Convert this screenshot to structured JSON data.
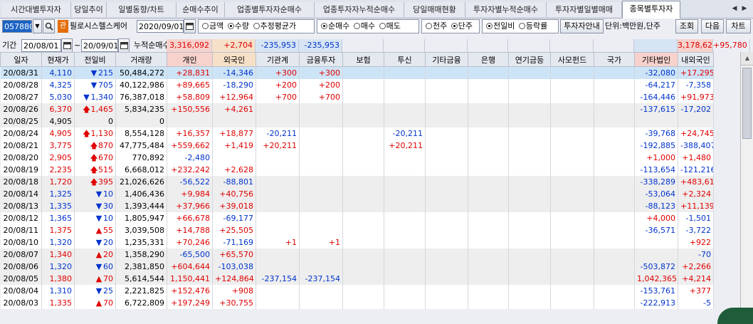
{
  "tabs": [
    "시간대별투자자",
    "당일추이",
    "일별동향/차트",
    "순매수추이",
    "업종별투자자순매수",
    "업종투자자누적순매수",
    "당일매매현황",
    "투자자별누적순매수",
    "투자자별일별매매",
    "종목별투자자"
  ],
  "active_tab": 9,
  "toolbar": {
    "stock_code": "057880",
    "badge": "관",
    "stock_name": "필로시스헬스케어",
    "date": "2020/09/01",
    "group1": [
      "금액",
      "수량",
      "추정평균가"
    ],
    "group2": [
      "순매수",
      "매수",
      "매도"
    ],
    "group3": [
      "천주",
      "단주"
    ],
    "group4": [
      "전일비",
      "등락률"
    ],
    "investor_info_button": "투자자안내",
    "unit_label": "단위:백만원,단주",
    "query_button": "조회",
    "next_button": "다음",
    "chart_button": "차트"
  },
  "period": {
    "label": "기간",
    "from": "20/08/01",
    "tilde": "~",
    "to": "20/09/01",
    "cumulative_label": "누적순매수",
    "values": [
      "3,316,092",
      "+2,704",
      "-235,953",
      "-235,953",
      "",
      "",
      "",
      "",
      "",
      "",
      "",
      "",
      "3,178,623",
      "+95,780"
    ]
  },
  "columns": [
    "일자",
    "현재가",
    "전일비",
    "거래량",
    "개인",
    "외국인",
    "기관계",
    "금융투자",
    "보험",
    "투신",
    "기타금융",
    "은행",
    "연기금등",
    "사모펀드",
    "국가",
    "기타법인",
    "내외국인"
  ],
  "rows": [
    {
      "style": "hl",
      "date": "20/08/31",
      "price": "4,110",
      "dir": "dn",
      "chg": "215",
      "vol": "50,484,272",
      "ind": "+28,831",
      "for": "-14,346",
      "inst": "+300",
      "fin": "+300",
      "ins": "",
      "trust": "",
      "etcfin": "",
      "bank": "",
      "pension": "",
      "pe": "",
      "gov": "",
      "etccorp": "-32,080",
      "dom": "+17,295"
    },
    {
      "style": "norm",
      "date": "20/08/28",
      "price": "4,325",
      "dir": "dn",
      "chg": "705",
      "vol": "40,122,986",
      "ind": "+89,665",
      "for": "-18,290",
      "inst": "+200",
      "fin": "+200",
      "ins": "",
      "trust": "",
      "etcfin": "",
      "bank": "",
      "pension": "",
      "pe": "",
      "gov": "",
      "etccorp": "-64,217",
      "dom": "-7,358"
    },
    {
      "style": "norm",
      "date": "20/08/27",
      "price": "5,030",
      "dir": "dn",
      "chg": "1,340",
      "vol": "76,387,018",
      "ind": "+58,809",
      "for": "+12,964",
      "inst": "+700",
      "fin": "+700",
      "ins": "",
      "trust": "",
      "etcfin": "",
      "bank": "",
      "pension": "",
      "pe": "",
      "gov": "",
      "etccorp": "-164,446",
      "dom": "+91,973"
    },
    {
      "style": "alt",
      "date": "20/08/26",
      "price": "6,370",
      "dir": "upb",
      "chg": "1,465",
      "vol": "5,834,235",
      "ind": "+150,556",
      "for": "+4,261",
      "inst": "",
      "fin": "",
      "ins": "",
      "trust": "",
      "etcfin": "",
      "bank": "",
      "pension": "",
      "pe": "",
      "gov": "",
      "etccorp": "-137,615",
      "dom": "-17,202"
    },
    {
      "style": "alt",
      "date": "20/08/25",
      "price": "4,905",
      "dir": "",
      "chg": "0",
      "vol": "0",
      "ind": "",
      "for": "",
      "inst": "",
      "fin": "",
      "ins": "",
      "trust": "",
      "etcfin": "",
      "bank": "",
      "pension": "",
      "pe": "",
      "gov": "",
      "etccorp": "",
      "dom": ""
    },
    {
      "style": "norm",
      "date": "20/08/24",
      "price": "4,905",
      "dir": "upb",
      "chg": "1,130",
      "vol": "8,554,128",
      "ind": "+16,357",
      "for": "+18,877",
      "inst": "-20,211",
      "fin": "",
      "ins": "",
      "trust": "-20,211",
      "etcfin": "",
      "bank": "",
      "pension": "",
      "pe": "",
      "gov": "",
      "etccorp": "-39,768",
      "dom": "+24,745"
    },
    {
      "style": "norm",
      "date": "20/08/21",
      "price": "3,775",
      "dir": "upb",
      "chg": "870",
      "vol": "47,775,484",
      "ind": "+559,662",
      "for": "+1,419",
      "inst": "+20,211",
      "fin": "",
      "ins": "",
      "trust": "+20,211",
      "etcfin": "",
      "bank": "",
      "pension": "",
      "pe": "",
      "gov": "",
      "etccorp": "-192,885",
      "dom": "-388,407"
    },
    {
      "style": "norm",
      "date": "20/08/20",
      "price": "2,905",
      "dir": "upb",
      "chg": "670",
      "vol": "770,892",
      "ind": "-2,480",
      "for": "",
      "inst": "",
      "fin": "",
      "ins": "",
      "trust": "",
      "etcfin": "",
      "bank": "",
      "pension": "",
      "pe": "",
      "gov": "",
      "etccorp": "+1,000",
      "dom": "+1,480"
    },
    {
      "style": "norm",
      "date": "20/08/19",
      "price": "2,235",
      "dir": "upb",
      "chg": "515",
      "vol": "6,668,012",
      "ind": "+232,242",
      "for": "+2,628",
      "inst": "",
      "fin": "",
      "ins": "",
      "trust": "",
      "etcfin": "",
      "bank": "",
      "pension": "",
      "pe": "",
      "gov": "",
      "etccorp": "-113,654",
      "dom": "-121,216"
    },
    {
      "style": "alt",
      "date": "20/08/18",
      "price": "1,720",
      "dir": "upb",
      "chg": "395",
      "vol": "21,026,626",
      "ind": "-56,522",
      "for": "-88,801",
      "inst": "",
      "fin": "",
      "ins": "",
      "trust": "",
      "etcfin": "",
      "bank": "",
      "pension": "",
      "pe": "",
      "gov": "",
      "etccorp": "-338,289",
      "dom": "+483,612"
    },
    {
      "style": "alt",
      "date": "20/08/14",
      "price": "1,325",
      "dir": "dn",
      "chg": "10",
      "vol": "1,406,436",
      "ind": "+9,984",
      "for": "+40,756",
      "inst": "",
      "fin": "",
      "ins": "",
      "trust": "",
      "etcfin": "",
      "bank": "",
      "pension": "",
      "pe": "",
      "gov": "",
      "etccorp": "-53,064",
      "dom": "+2,324"
    },
    {
      "style": "alt",
      "date": "20/08/13",
      "price": "1,335",
      "dir": "dn",
      "chg": "30",
      "vol": "1,393,444",
      "ind": "+37,966",
      "for": "+39,018",
      "inst": "",
      "fin": "",
      "ins": "",
      "trust": "",
      "etcfin": "",
      "bank": "",
      "pension": "",
      "pe": "",
      "gov": "",
      "etccorp": "-88,123",
      "dom": "+11,139"
    },
    {
      "style": "norm",
      "date": "20/08/12",
      "price": "1,365",
      "dir": "dn",
      "chg": "10",
      "vol": "1,805,947",
      "ind": "+66,678",
      "for": "-69,177",
      "inst": "",
      "fin": "",
      "ins": "",
      "trust": "",
      "etcfin": "",
      "bank": "",
      "pension": "",
      "pe": "",
      "gov": "",
      "etccorp": "+4,000",
      "dom": "-1,501"
    },
    {
      "style": "norm",
      "date": "20/08/11",
      "price": "1,375",
      "dir": "up",
      "chg": "55",
      "vol": "3,039,508",
      "ind": "+14,788",
      "for": "+25,505",
      "inst": "",
      "fin": "",
      "ins": "",
      "trust": "",
      "etcfin": "",
      "bank": "",
      "pension": "",
      "pe": "",
      "gov": "",
      "etccorp": "-36,571",
      "dom": "-3,722"
    },
    {
      "style": "norm",
      "date": "20/08/10",
      "price": "1,320",
      "dir": "dn",
      "chg": "20",
      "vol": "1,235,331",
      "ind": "+70,246",
      "for": "-71,169",
      "inst": "+1",
      "fin": "+1",
      "ins": "",
      "trust": "",
      "etcfin": "",
      "bank": "",
      "pension": "",
      "pe": "",
      "gov": "",
      "etccorp": "",
      "dom": "+922"
    },
    {
      "style": "alt",
      "date": "20/08/07",
      "price": "1,340",
      "dir": "up",
      "chg": "20",
      "vol": "1,358,290",
      "ind": "-65,500",
      "for": "+65,570",
      "inst": "",
      "fin": "",
      "ins": "",
      "trust": "",
      "etcfin": "",
      "bank": "",
      "pension": "",
      "pe": "",
      "gov": "",
      "etccorp": "",
      "dom": "-70"
    },
    {
      "style": "alt",
      "date": "20/08/06",
      "price": "1,320",
      "dir": "dn",
      "chg": "60",
      "vol": "2,381,850",
      "ind": "+604,644",
      "for": "-103,038",
      "inst": "",
      "fin": "",
      "ins": "",
      "trust": "",
      "etcfin": "",
      "bank": "",
      "pension": "",
      "pe": "",
      "gov": "",
      "etccorp": "-503,872",
      "dom": "+2,266"
    },
    {
      "style": "alt",
      "date": "20/08/05",
      "price": "1,380",
      "dir": "up",
      "chg": "70",
      "vol": "5,614,544",
      "ind": "1,150,441",
      "for": "+124,864",
      "inst": "-237,154",
      "fin": "-237,154",
      "ins": "",
      "trust": "",
      "etcfin": "",
      "bank": "",
      "pension": "",
      "pe": "",
      "gov": "",
      "etccorp": "1,042,365",
      "dom": "+4,214"
    },
    {
      "style": "norm",
      "date": "20/08/04",
      "price": "1,310",
      "dir": "dn",
      "chg": "25",
      "vol": "2,221,825",
      "ind": "+152,476",
      "for": "+908",
      "inst": "",
      "fin": "",
      "ins": "",
      "trust": "",
      "etcfin": "",
      "bank": "",
      "pension": "",
      "pe": "",
      "gov": "",
      "etccorp": "-153,761",
      "dom": "+377"
    },
    {
      "style": "norm",
      "date": "20/08/03",
      "price": "1,335",
      "dir": "up",
      "chg": "70",
      "vol": "6,722,809",
      "ind": "+197,249",
      "for": "+30,755",
      "inst": "",
      "fin": "",
      "ins": "",
      "trust": "",
      "etcfin": "",
      "bank": "",
      "pension": "",
      "pe": "",
      "gov": "",
      "etccorp": "-222,913",
      "dom": "-5"
    }
  ]
}
